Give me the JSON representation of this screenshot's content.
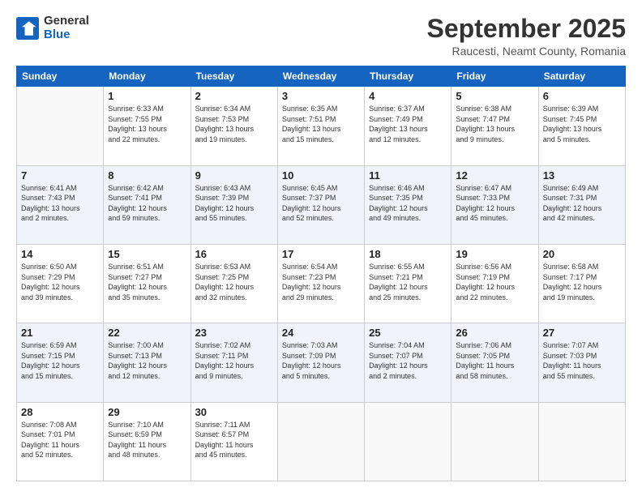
{
  "header": {
    "logo_general": "General",
    "logo_blue": "Blue",
    "month": "September 2025",
    "location": "Raucesti, Neamt County, Romania"
  },
  "weekdays": [
    "Sunday",
    "Monday",
    "Tuesday",
    "Wednesday",
    "Thursday",
    "Friday",
    "Saturday"
  ],
  "weeks": [
    [
      {
        "day": "",
        "text": ""
      },
      {
        "day": "1",
        "text": "Sunrise: 6:33 AM\nSunset: 7:55 PM\nDaylight: 13 hours\nand 22 minutes."
      },
      {
        "day": "2",
        "text": "Sunrise: 6:34 AM\nSunset: 7:53 PM\nDaylight: 13 hours\nand 19 minutes."
      },
      {
        "day": "3",
        "text": "Sunrise: 6:35 AM\nSunset: 7:51 PM\nDaylight: 13 hours\nand 15 minutes."
      },
      {
        "day": "4",
        "text": "Sunrise: 6:37 AM\nSunset: 7:49 PM\nDaylight: 13 hours\nand 12 minutes."
      },
      {
        "day": "5",
        "text": "Sunrise: 6:38 AM\nSunset: 7:47 PM\nDaylight: 13 hours\nand 9 minutes."
      },
      {
        "day": "6",
        "text": "Sunrise: 6:39 AM\nSunset: 7:45 PM\nDaylight: 13 hours\nand 5 minutes."
      }
    ],
    [
      {
        "day": "7",
        "text": "Sunrise: 6:41 AM\nSunset: 7:43 PM\nDaylight: 13 hours\nand 2 minutes."
      },
      {
        "day": "8",
        "text": "Sunrise: 6:42 AM\nSunset: 7:41 PM\nDaylight: 12 hours\nand 59 minutes."
      },
      {
        "day": "9",
        "text": "Sunrise: 6:43 AM\nSunset: 7:39 PM\nDaylight: 12 hours\nand 55 minutes."
      },
      {
        "day": "10",
        "text": "Sunrise: 6:45 AM\nSunset: 7:37 PM\nDaylight: 12 hours\nand 52 minutes."
      },
      {
        "day": "11",
        "text": "Sunrise: 6:46 AM\nSunset: 7:35 PM\nDaylight: 12 hours\nand 49 minutes."
      },
      {
        "day": "12",
        "text": "Sunrise: 6:47 AM\nSunset: 7:33 PM\nDaylight: 12 hours\nand 45 minutes."
      },
      {
        "day": "13",
        "text": "Sunrise: 6:49 AM\nSunset: 7:31 PM\nDaylight: 12 hours\nand 42 minutes."
      }
    ],
    [
      {
        "day": "14",
        "text": "Sunrise: 6:50 AM\nSunset: 7:29 PM\nDaylight: 12 hours\nand 39 minutes."
      },
      {
        "day": "15",
        "text": "Sunrise: 6:51 AM\nSunset: 7:27 PM\nDaylight: 12 hours\nand 35 minutes."
      },
      {
        "day": "16",
        "text": "Sunrise: 6:53 AM\nSunset: 7:25 PM\nDaylight: 12 hours\nand 32 minutes."
      },
      {
        "day": "17",
        "text": "Sunrise: 6:54 AM\nSunset: 7:23 PM\nDaylight: 12 hours\nand 29 minutes."
      },
      {
        "day": "18",
        "text": "Sunrise: 6:55 AM\nSunset: 7:21 PM\nDaylight: 12 hours\nand 25 minutes."
      },
      {
        "day": "19",
        "text": "Sunrise: 6:56 AM\nSunset: 7:19 PM\nDaylight: 12 hours\nand 22 minutes."
      },
      {
        "day": "20",
        "text": "Sunrise: 6:58 AM\nSunset: 7:17 PM\nDaylight: 12 hours\nand 19 minutes."
      }
    ],
    [
      {
        "day": "21",
        "text": "Sunrise: 6:59 AM\nSunset: 7:15 PM\nDaylight: 12 hours\nand 15 minutes."
      },
      {
        "day": "22",
        "text": "Sunrise: 7:00 AM\nSunset: 7:13 PM\nDaylight: 12 hours\nand 12 minutes."
      },
      {
        "day": "23",
        "text": "Sunrise: 7:02 AM\nSunset: 7:11 PM\nDaylight: 12 hours\nand 9 minutes."
      },
      {
        "day": "24",
        "text": "Sunrise: 7:03 AM\nSunset: 7:09 PM\nDaylight: 12 hours\nand 5 minutes."
      },
      {
        "day": "25",
        "text": "Sunrise: 7:04 AM\nSunset: 7:07 PM\nDaylight: 12 hours\nand 2 minutes."
      },
      {
        "day": "26",
        "text": "Sunrise: 7:06 AM\nSunset: 7:05 PM\nDaylight: 11 hours\nand 58 minutes."
      },
      {
        "day": "27",
        "text": "Sunrise: 7:07 AM\nSunset: 7:03 PM\nDaylight: 11 hours\nand 55 minutes."
      }
    ],
    [
      {
        "day": "28",
        "text": "Sunrise: 7:08 AM\nSunset: 7:01 PM\nDaylight: 11 hours\nand 52 minutes."
      },
      {
        "day": "29",
        "text": "Sunrise: 7:10 AM\nSunset: 6:59 PM\nDaylight: 11 hours\nand 48 minutes."
      },
      {
        "day": "30",
        "text": "Sunrise: 7:11 AM\nSunset: 6:57 PM\nDaylight: 11 hours\nand 45 minutes."
      },
      {
        "day": "",
        "text": ""
      },
      {
        "day": "",
        "text": ""
      },
      {
        "day": "",
        "text": ""
      },
      {
        "day": "",
        "text": ""
      }
    ]
  ]
}
